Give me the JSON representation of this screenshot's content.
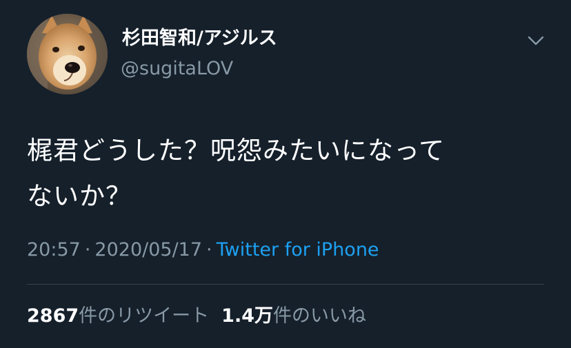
{
  "tweet": {
    "author": {
      "display_name": "杉田智和/アジルス",
      "handle": "@sugitaLOV",
      "avatar_icon": "dog-avatar"
    },
    "menu_icon": "chevron-down-icon",
    "text_line1": "梶君どうした？呪怨みたいになって",
    "text_line2": "ないか？",
    "time": "20:57",
    "separator": "·",
    "date": "2020/05/17",
    "source": "Twitter for iPhone",
    "retweets": {
      "count": "2867",
      "label": "件のリツイート"
    },
    "likes": {
      "count": "1.4万",
      "label": "件のいいね"
    }
  },
  "colors": {
    "background": "#15202b",
    "primary_text": "#ffffff",
    "secondary_text": "#8899a6",
    "link": "#1da1f2",
    "divider": "#38444d"
  }
}
